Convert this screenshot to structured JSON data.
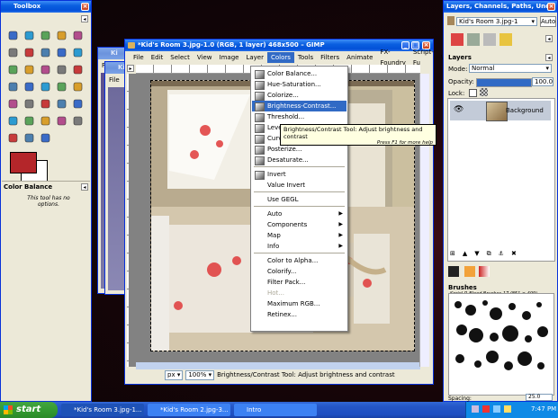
{
  "toolbox": {
    "title": "Toolbox",
    "tools": [
      "rect-select-icon",
      "ellipse-select-icon",
      "lasso-icon",
      "fuzzy-select-icon",
      "color-select-icon",
      "scissors-icon",
      "paths-icon",
      "color-picker-icon",
      "zoom-icon",
      "measure-icon",
      "move-icon",
      "crop-icon",
      "rotate-icon",
      "scale-icon",
      "shear-icon",
      "perspective-icon",
      "flip-icon",
      "text-icon",
      "bucket-fill-icon",
      "blend-icon",
      "pencil-icon",
      "paintbrush-icon",
      "eraser-icon",
      "airbrush-icon",
      "ink-icon",
      "clone-icon",
      "heal-icon",
      "convolve-icon",
      "smudge-icon",
      "dodge-burn-icon",
      "flask-icon",
      "paint-icon",
      "stamp-icon"
    ],
    "fg_color": "#b4262a",
    "bg_color": "#ffffff",
    "options_title": "Color Balance",
    "options_text": "This tool has no options."
  },
  "back_windows": [
    {
      "title": "Ki",
      "menu": "File"
    },
    {
      "title": "Ki",
      "menu": "File"
    }
  ],
  "main_window": {
    "title": "*Kid's Room 3.jpg-1.0 (RGB, 1 layer) 468x500 – GIMP",
    "menus": [
      "File",
      "Edit",
      "Select",
      "View",
      "Image",
      "Layer",
      "Colors",
      "Tools",
      "Filters",
      "Animate",
      "FX-Foundry",
      "Script-Fu",
      "Windo"
    ],
    "open_menu": "Colors",
    "status_unit": "px",
    "zoom": "100%",
    "status_text": "Brightness/Contrast Tool: Adjust brightness and contrast"
  },
  "colors_menu": {
    "items": [
      {
        "label": "Color Balance...",
        "icon": "color-balance-icon"
      },
      {
        "label": "Hue-Saturation...",
        "icon": "hue-saturation-icon"
      },
      {
        "label": "Colorize...",
        "icon": "colorize-icon"
      },
      {
        "label": "Brightness-Contrast...",
        "icon": "brightness-contrast-icon",
        "selected": true
      },
      {
        "label": "Threshold...",
        "icon": "threshold-icon"
      },
      {
        "label": "Levels...",
        "icon": "levels-icon"
      },
      {
        "label": "Curves...",
        "icon": "curves-icon"
      },
      {
        "label": "Posterize...",
        "icon": "posterize-icon"
      },
      {
        "label": "Desaturate...",
        "icon": "desaturate-icon"
      },
      {
        "sep": true
      },
      {
        "label": "Invert",
        "icon": "invert-icon"
      },
      {
        "label": "Value Invert"
      },
      {
        "sep": true
      },
      {
        "label": "Use GEGL"
      },
      {
        "sep": true
      },
      {
        "label": "Auto",
        "submenu": true
      },
      {
        "label": "Components",
        "submenu": true
      },
      {
        "label": "Map",
        "submenu": true
      },
      {
        "label": "Info",
        "submenu": true
      },
      {
        "sep": true
      },
      {
        "label": "Color to Alpha..."
      },
      {
        "label": "Colorify..."
      },
      {
        "label": "Filter Pack..."
      },
      {
        "label": "Hot...",
        "disabled": true
      },
      {
        "label": "Maximum RGB..."
      },
      {
        "label": "Retinex..."
      }
    ]
  },
  "tooltip": {
    "text": "Brightness/Contrast Tool: Adjust brightness and contrast",
    "hint": "Press F1 for more help"
  },
  "dock": {
    "title": "Layers, Channels, Paths, Undo ...",
    "image_selector": "Kid's Room 3.jpg-1",
    "auto_button": "Auto",
    "layers_label": "Layers",
    "mode_label": "Mode:",
    "mode_value": "Normal",
    "opacity_label": "Opacity:",
    "opacity_value": "100.0",
    "opacity_fraction": 1.0,
    "lock_label": "Lock:",
    "layer_name": "Background",
    "brushes_label": "Brushes",
    "brush_name": "Keriel-R-Bleed Brushes-17 (851 × 409)",
    "spacing_label": "Spacing:",
    "spacing_value": "25.0"
  },
  "taskbar": {
    "start_label": "start",
    "tasks": [
      "*Kid's Room 3.jpg-1...",
      "*Kid's Room 2.jpg-3...",
      "Intro"
    ],
    "clock": "7:47 PM"
  },
  "colors": {
    "xp_blue": "#0a5fe0",
    "menu_highlight": "#316ac5",
    "tooltip_bg": "#ffffe1",
    "taskbar_blue": "#2456c7",
    "start_green": "#339a32"
  }
}
